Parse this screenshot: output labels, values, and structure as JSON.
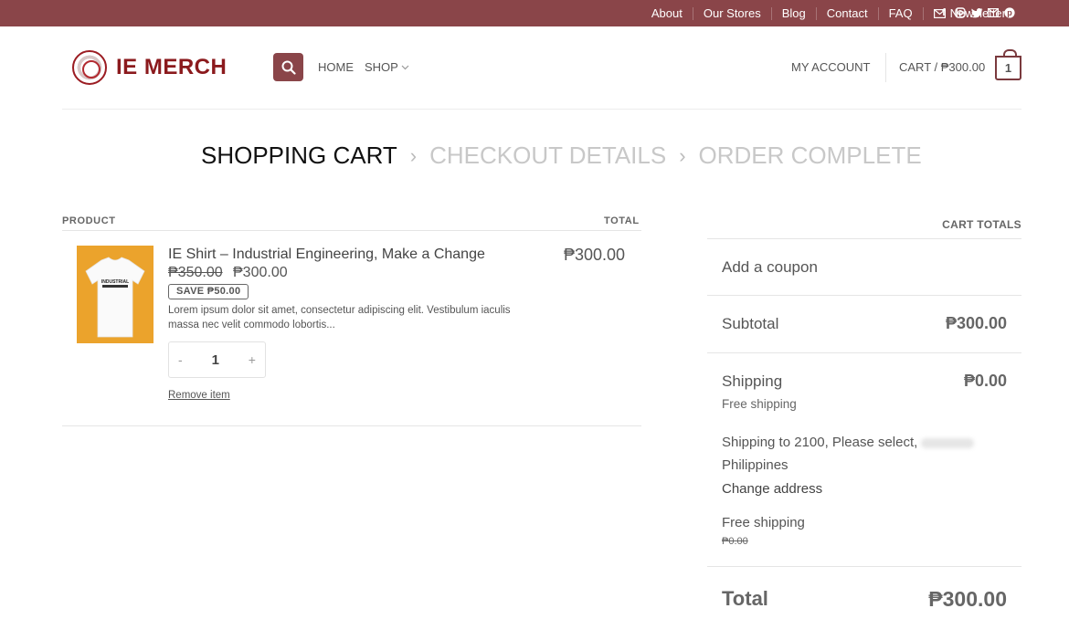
{
  "topbar": {
    "links": [
      "About",
      "Our Stores",
      "Blog",
      "Contact",
      "FAQ"
    ],
    "newsletter": "Newsletter",
    "social_icons": [
      "facebook-icon",
      "instagram-icon",
      "twitter-icon",
      "email-icon",
      "pinterest-icon"
    ]
  },
  "header": {
    "logo_text": "IE MERCH",
    "nav": {
      "home": "HOME",
      "shop": "SHOP"
    },
    "account": "MY ACCOUNT",
    "cart_label": "CART / ₱300.00",
    "cart_count": "1"
  },
  "steps": {
    "current": "SHOPPING CART",
    "checkout": "CHECKOUT DETAILS",
    "complete": "ORDER COMPLETE"
  },
  "table": {
    "col_product": "PRODUCT",
    "col_total": "TOTAL"
  },
  "item": {
    "name": "IE Shirt – Industrial Engineering, Make a Change",
    "price_old": "₱350.00",
    "price_new": "₱300.00",
    "save_badge": "SAVE ₱50.00",
    "description": "Lorem ipsum dolor sit amet, consectetur adipiscing elit. Vestibulum iaculis massa nec velit commodo lobortis...",
    "qty_minus": "-",
    "quantity": "1",
    "qty_plus": "+",
    "remove": "Remove item",
    "line_total": "₱300.00",
    "shirt_print": "INDUSTRIAL"
  },
  "totals": {
    "title": "CART TOTALS",
    "coupon": "Add a coupon",
    "subtotal_label": "Subtotal",
    "subtotal_value": "₱300.00",
    "shipping_label": "Shipping",
    "shipping_value": "₱0.00",
    "free_shipping": "Free shipping",
    "shipping_to": "Shipping to 2100, Please select,",
    "country": "Philippines",
    "change_address": "Change address",
    "option_label": "Free shipping",
    "option_price": "₱0.00",
    "total_label": "Total",
    "total_value": "₱300.00"
  },
  "colors": {
    "brand": "#8a4549",
    "logo_red": "#8b1a1d"
  }
}
